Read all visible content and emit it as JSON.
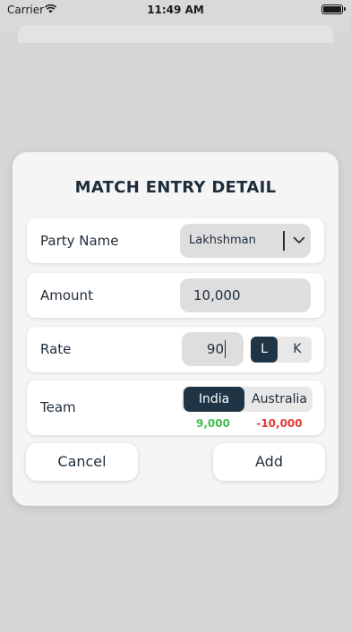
{
  "status_bar": {
    "carrier": "Carrier",
    "time": "11:49 AM"
  },
  "form": {
    "title": "MATCH ENTRY DETAIL",
    "party_name": {
      "label": "Party Name",
      "value": "Lakhshman"
    },
    "amount": {
      "label": "Amount",
      "value": "10,000"
    },
    "rate": {
      "label": "Rate",
      "value": "90",
      "options": [
        "L",
        "K"
      ],
      "selected": "L"
    },
    "team": {
      "label": "Team",
      "options": [
        "India",
        "Australia"
      ],
      "selected": "India",
      "values": [
        "9,000",
        "-10,000"
      ]
    }
  },
  "buttons": {
    "cancel": "Cancel",
    "add": "Add"
  },
  "colors": {
    "accent": "#1f3444",
    "positive": "#3fbf4a",
    "negative": "#e53935",
    "card": "#f5f5f5",
    "backdrop": "#d9d9d9"
  },
  "icons": {
    "wifi": "wifi-icon",
    "battery": "battery-icon",
    "dropdown": "chevron-down-icon"
  }
}
